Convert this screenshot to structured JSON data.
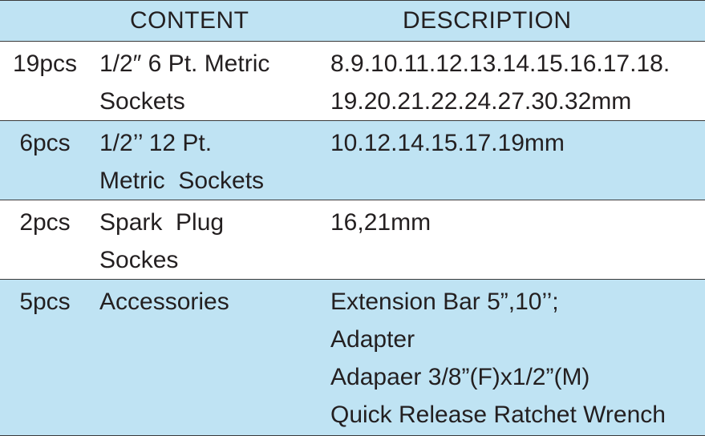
{
  "table": {
    "headers": {
      "qty": "",
      "content": "CONTENT",
      "description": "DESCRIPTION"
    },
    "rows": [
      {
        "qty": "19pcs",
        "content": [
          "1/2″ 6 Pt. Metric",
          "Sockets"
        ],
        "description": [
          "8.9.10.11.12.13.14.15.16.17.18.",
          "19.20.21.22.24.27.30.32mm"
        ]
      },
      {
        "qty": "6pcs",
        "content": [
          "1/2’’ 12 Pt.",
          "Metric  Sockets"
        ],
        "description": [
          "10.12.14.15.17.19mm"
        ]
      },
      {
        "qty": "2pcs",
        "content": [
          "Spark  Plug",
          "Sockes"
        ],
        "description": [
          "16,21mm"
        ]
      },
      {
        "qty": "5pcs",
        "content": [
          "Accessories"
        ],
        "description": [
          "Extension Bar 5”,10’’;",
          "Adapter",
          "Adapaer 3/8”(F)x1/2”(M)",
          "Quick Release Ratchet Wrench"
        ]
      }
    ]
  },
  "colors": {
    "band": "#bfe3f3",
    "text": "#231f20",
    "rule": "#3a3a3a"
  }
}
